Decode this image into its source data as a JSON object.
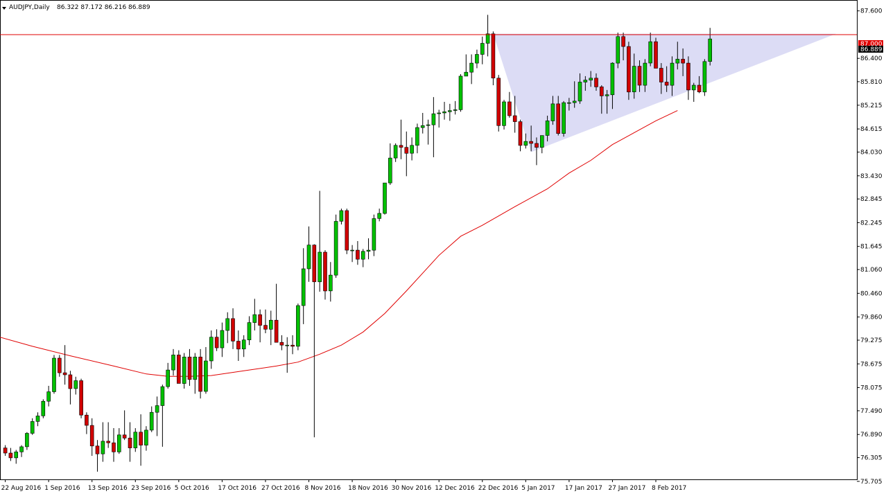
{
  "header": {
    "symbol_label": "AUDJPY,Daily",
    "ohlc_label": "86.322 87.172 86.216 86.889"
  },
  "colors": {
    "bull": "#00c000",
    "bear": "#d00000",
    "wick": "#000000",
    "resistance": "#e00000",
    "ma": "#e00000",
    "triangle_fill": "#dcdcf5",
    "price_tag_red": "#e00000",
    "price_tag_black": "#000000"
  },
  "chart_data": {
    "type": "candlestick",
    "symbol": "AUDJPY",
    "timeframe": "Daily",
    "ylim": [
      75.755,
      87.875
    ],
    "y_ticks": [
      "87.600",
      "87.000",
      "86.889",
      "86.400",
      "85.810",
      "85.215",
      "84.615",
      "84.030",
      "83.430",
      "82.845",
      "82.245",
      "81.645",
      "81.060",
      "80.460",
      "79.860",
      "79.275",
      "78.675",
      "78.075",
      "77.490",
      "76.890",
      "76.305",
      "75.705"
    ],
    "x_labels": [
      {
        "label": "22 Aug 2016",
        "index": 0
      },
      {
        "label": "1 Sep 2016",
        "index": 8
      },
      {
        "label": "13 Sep 2016",
        "index": 16
      },
      {
        "label": "23 Sep 2016",
        "index": 24
      },
      {
        "label": "5 Oct 2016",
        "index": 32
      },
      {
        "label": "17 Oct 2016",
        "index": 40
      },
      {
        "label": "27 Oct 2016",
        "index": 48
      },
      {
        "label": "8 Nov 2016",
        "index": 56
      },
      {
        "label": "18 Nov 2016",
        "index": 64
      },
      {
        "label": "30 Nov 2016",
        "index": 72
      },
      {
        "label": "12 Dec 2016",
        "index": 80
      },
      {
        "label": "22 Dec 2016",
        "index": 88
      },
      {
        "label": "5 Jan 2017",
        "index": 96
      },
      {
        "label": "17 Jan 2017",
        "index": 104
      },
      {
        "label": "27 Jan 2017",
        "index": 112
      },
      {
        "label": "8 Feb 2017",
        "index": 120
      }
    ],
    "candles": [
      [
        76.55,
        76.62,
        76.35,
        76.42
      ],
      [
        76.42,
        76.55,
        76.22,
        76.3
      ],
      [
        76.3,
        76.5,
        76.15,
        76.45
      ],
      [
        76.45,
        76.62,
        76.32,
        76.58
      ],
      [
        76.58,
        76.95,
        76.5,
        76.92
      ],
      [
        76.92,
        77.3,
        76.88,
        77.22
      ],
      [
        77.22,
        77.45,
        77.1,
        77.36
      ],
      [
        77.36,
        77.78,
        77.3,
        77.73
      ],
      [
        77.73,
        78.12,
        77.6,
        77.97
      ],
      [
        77.97,
        78.9,
        77.92,
        78.82
      ],
      [
        78.82,
        78.9,
        78.35,
        78.45
      ],
      [
        78.45,
        79.15,
        78.15,
        78.4
      ],
      [
        78.4,
        78.5,
        77.65,
        78.05
      ],
      [
        78.05,
        78.35,
        77.9,
        78.25
      ],
      [
        78.25,
        78.3,
        77.3,
        77.38
      ],
      [
        77.38,
        77.45,
        76.9,
        77.12
      ],
      [
        77.12,
        77.3,
        76.35,
        76.6
      ],
      [
        76.6,
        76.75,
        75.95,
        76.4
      ],
      [
        76.4,
        77.2,
        76.2,
        76.72
      ],
      [
        76.72,
        77.2,
        76.55,
        76.68
      ],
      [
        76.68,
        77.05,
        76.2,
        76.45
      ],
      [
        76.45,
        77.05,
        76.4,
        76.88
      ],
      [
        76.88,
        77.5,
        76.75,
        76.8
      ],
      [
        76.8,
        77.2,
        76.2,
        76.55
      ],
      [
        76.55,
        77.05,
        76.45,
        76.95
      ],
      [
        76.95,
        77.4,
        76.1,
        76.62
      ],
      [
        76.62,
        77.1,
        76.48,
        77.0
      ],
      [
        77.0,
        77.6,
        76.95,
        77.45
      ],
      [
        77.45,
        77.85,
        76.85,
        77.62
      ],
      [
        77.62,
        78.15,
        76.58,
        78.1
      ],
      [
        78.1,
        78.7,
        78.05,
        78.52
      ],
      [
        78.52,
        79.05,
        78.38,
        78.9
      ],
      [
        78.9,
        79.02,
        78.3,
        78.18
      ],
      [
        78.18,
        78.95,
        78.05,
        78.85
      ],
      [
        78.85,
        79.05,
        78.12,
        78.28
      ],
      [
        78.28,
        78.95,
        77.92,
        78.85
      ],
      [
        78.85,
        79.05,
        77.8,
        77.98
      ],
      [
        77.98,
        79.1,
        77.92,
        78.75
      ],
      [
        78.75,
        79.52,
        78.55,
        79.35
      ],
      [
        79.35,
        79.55,
        79.0,
        79.08
      ],
      [
        79.08,
        79.72,
        78.85,
        79.52
      ],
      [
        79.52,
        79.98,
        79.2,
        79.82
      ],
      [
        79.82,
        80.08,
        79.05,
        79.25
      ],
      [
        79.25,
        79.52,
        78.75,
        79.05
      ],
      [
        79.05,
        79.4,
        78.85,
        79.28
      ],
      [
        79.28,
        79.88,
        79.15,
        79.72
      ],
      [
        79.72,
        80.32,
        79.52,
        79.92
      ],
      [
        79.92,
        80.05,
        79.22,
        79.65
      ],
      [
        79.65,
        80.05,
        79.45,
        79.55
      ],
      [
        79.55,
        80.02,
        79.15,
        79.78
      ],
      [
        79.78,
        80.7,
        79.25,
        79.22
      ],
      [
        79.22,
        79.4,
        79.02,
        79.15
      ],
      [
        79.15,
        79.35,
        78.45,
        79.15
      ],
      [
        79.15,
        79.4,
        78.92,
        79.12
      ],
      [
        79.12,
        80.2,
        79.02,
        80.15
      ],
      [
        80.15,
        81.6,
        79.68,
        81.08
      ],
      [
        81.08,
        82.15,
        80.75,
        81.68
      ],
      [
        81.68,
        81.7,
        76.82,
        80.75
      ],
      [
        80.75,
        83.05,
        80.5,
        81.5
      ],
      [
        81.5,
        81.55,
        80.3,
        80.52
      ],
      [
        80.52,
        81.25,
        80.25,
        80.92
      ],
      [
        80.92,
        82.45,
        80.85,
        82.28
      ],
      [
        82.28,
        82.6,
        82.2,
        82.55
      ],
      [
        82.55,
        82.6,
        81.45,
        81.55
      ],
      [
        81.55,
        81.68,
        81.25,
        81.55
      ],
      [
        81.55,
        81.78,
        81.18,
        81.32
      ],
      [
        81.32,
        81.58,
        81.12,
        81.52
      ],
      [
        81.52,
        81.85,
        81.32,
        81.55
      ],
      [
        81.55,
        82.45,
        81.4,
        82.35
      ],
      [
        82.35,
        82.6,
        82.28,
        82.48
      ],
      [
        82.48,
        83.2,
        82.45,
        83.25
      ],
      [
        83.25,
        84.25,
        83.2,
        83.88
      ],
      [
        83.88,
        84.25,
        83.78,
        84.2
      ],
      [
        84.2,
        84.85,
        83.85,
        84.15
      ],
      [
        84.15,
        84.55,
        83.42,
        84.0
      ],
      [
        84.0,
        84.4,
        83.82,
        84.2
      ],
      [
        84.2,
        84.75,
        84.0,
        84.65
      ],
      [
        84.65,
        85.02,
        84.5,
        84.7
      ],
      [
        84.7,
        84.85,
        84.22,
        84.72
      ],
      [
        84.72,
        85.42,
        83.9,
        85.0
      ],
      [
        85.0,
        85.1,
        84.65,
        85.02
      ],
      [
        85.02,
        85.3,
        84.85,
        85.05
      ],
      [
        85.05,
        85.25,
        84.82,
        85.08
      ],
      [
        85.08,
        85.32,
        84.98,
        85.1
      ],
      [
        85.1,
        86.0,
        85.05,
        85.95
      ],
      [
        85.95,
        86.5,
        85.95,
        86.05
      ],
      [
        86.05,
        86.5,
        85.75,
        86.28
      ],
      [
        86.28,
        86.62,
        86.15,
        86.5
      ],
      [
        86.5,
        86.95,
        86.25,
        86.78
      ],
      [
        86.78,
        87.5,
        86.45,
        87.02
      ],
      [
        87.02,
        87.08,
        85.72,
        85.9
      ],
      [
        85.9,
        85.98,
        84.55,
        84.7
      ],
      [
        84.7,
        85.35,
        84.6,
        85.3
      ],
      [
        85.3,
        85.55,
        84.9,
        84.95
      ],
      [
        84.95,
        85.45,
        84.52,
        84.8
      ],
      [
        84.8,
        84.85,
        84.05,
        84.2
      ],
      [
        84.2,
        84.5,
        84.12,
        84.3
      ],
      [
        84.3,
        84.7,
        84.05,
        84.25
      ],
      [
        84.25,
        84.4,
        83.7,
        84.15
      ],
      [
        84.15,
        84.45,
        84.0,
        84.45
      ],
      [
        84.45,
        84.95,
        84.3,
        84.82
      ],
      [
        84.82,
        85.45,
        84.72,
        85.25
      ],
      [
        85.25,
        85.45,
        84.45,
        84.5
      ],
      [
        84.5,
        85.32,
        84.42,
        85.28
      ],
      [
        85.28,
        85.4,
        85.08,
        85.28
      ],
      [
        85.28,
        85.82,
        85.15,
        85.32
      ],
      [
        85.32,
        86.02,
        85.25,
        85.8
      ],
      [
        85.8,
        85.95,
        85.58,
        85.85
      ],
      [
        85.85,
        86.08,
        85.68,
        85.9
      ],
      [
        85.9,
        86.02,
        85.58,
        85.68
      ],
      [
        85.68,
        85.72,
        85.0,
        85.45
      ],
      [
        85.45,
        85.6,
        85.0,
        85.48
      ],
      [
        85.48,
        86.3,
        85.12,
        86.28
      ],
      [
        86.28,
        87.05,
        86.15,
        86.95
      ],
      [
        86.95,
        87.05,
        86.35,
        86.7
      ],
      [
        86.7,
        86.82,
        85.35,
        85.55
      ],
      [
        85.55,
        86.52,
        85.38,
        86.2
      ],
      [
        86.2,
        86.35,
        85.55,
        85.72
      ],
      [
        85.72,
        86.38,
        85.55,
        86.28
      ],
      [
        86.28,
        87.05,
        86.2,
        86.82
      ],
      [
        86.82,
        86.92,
        86.15,
        86.15
      ],
      [
        86.15,
        86.28,
        85.5,
        85.8
      ],
      [
        85.8,
        86.2,
        85.55,
        85.72
      ],
      [
        85.72,
        86.45,
        85.45,
        86.28
      ],
      [
        86.28,
        86.82,
        86.12,
        86.38
      ],
      [
        86.38,
        86.65,
        85.95,
        86.28
      ],
      [
        86.28,
        86.45,
        85.35,
        85.6
      ],
      [
        85.6,
        85.78,
        85.3,
        85.72
      ],
      [
        85.72,
        85.95,
        85.52,
        85.55
      ],
      [
        85.55,
        86.38,
        85.45,
        86.32
      ],
      [
        86.32,
        87.17,
        86.22,
        86.89
      ]
    ],
    "moving_average": [
      [
        -1,
        79.35
      ],
      [
        5,
        79.12
      ],
      [
        12,
        78.88
      ],
      [
        20,
        78.62
      ],
      [
        26,
        78.42
      ],
      [
        30,
        78.36
      ],
      [
        34,
        78.36
      ],
      [
        38,
        78.38
      ],
      [
        44,
        78.5
      ],
      [
        50,
        78.62
      ],
      [
        54,
        78.72
      ],
      [
        58,
        78.92
      ],
      [
        62,
        79.15
      ],
      [
        66,
        79.48
      ],
      [
        70,
        79.95
      ],
      [
        74,
        80.52
      ],
      [
        78,
        81.12
      ],
      [
        80,
        81.42
      ],
      [
        84,
        81.9
      ],
      [
        88,
        82.18
      ],
      [
        94,
        82.65
      ],
      [
        100,
        83.1
      ],
      [
        104,
        83.5
      ],
      [
        108,
        83.82
      ],
      [
        112,
        84.22
      ],
      [
        116,
        84.52
      ],
      [
        120,
        84.82
      ],
      [
        124,
        85.08
      ]
    ],
    "resistance": 87.0,
    "triangle": [
      [
        90,
        87.02
      ],
      [
        97,
        84.03
      ],
      [
        155,
        87.02
      ]
    ],
    "price_tag_red": "87.000",
    "price_tag_black": "86.889"
  }
}
